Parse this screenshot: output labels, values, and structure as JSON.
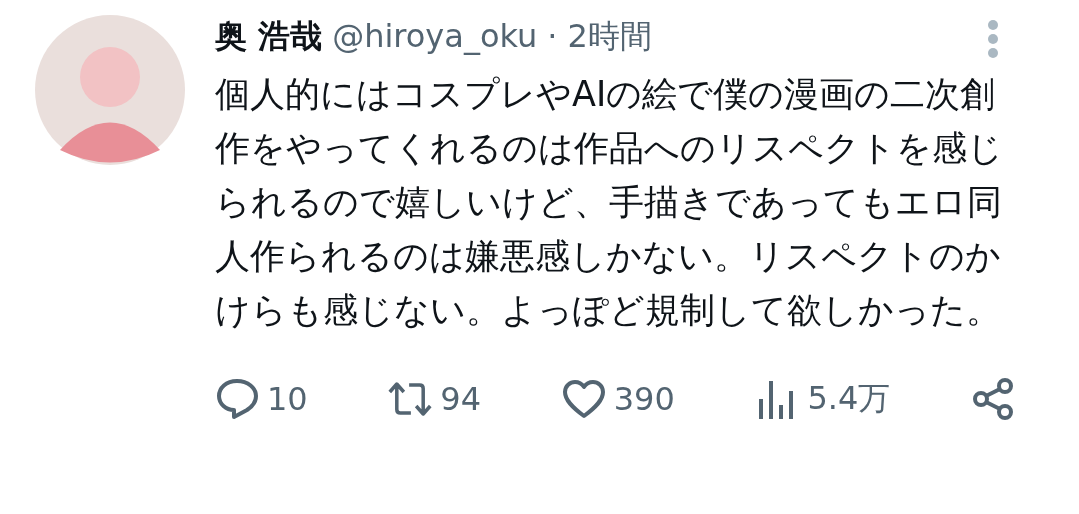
{
  "author": {
    "name": "奥 浩哉",
    "handle": "@hiroya_oku",
    "separator": "·",
    "time": "2時間"
  },
  "text": "個人的にはコスプレやAIの絵で僕の漫画の二次創作をやってくれるのは作品へのリスペクトを感じられるので嬉しいけど、手描きであってもエロ同人作られるのは嫌悪感しかない。リスペクトのかけらも感じない。よっぽど規制して欲しかった。",
  "actions": [
    {
      "kind": "reply",
      "count": "10"
    },
    {
      "kind": "repost",
      "count": "94"
    },
    {
      "kind": "like",
      "count": "390"
    },
    {
      "kind": "views",
      "count": "5.4万"
    },
    {
      "kind": "share"
    }
  ]
}
